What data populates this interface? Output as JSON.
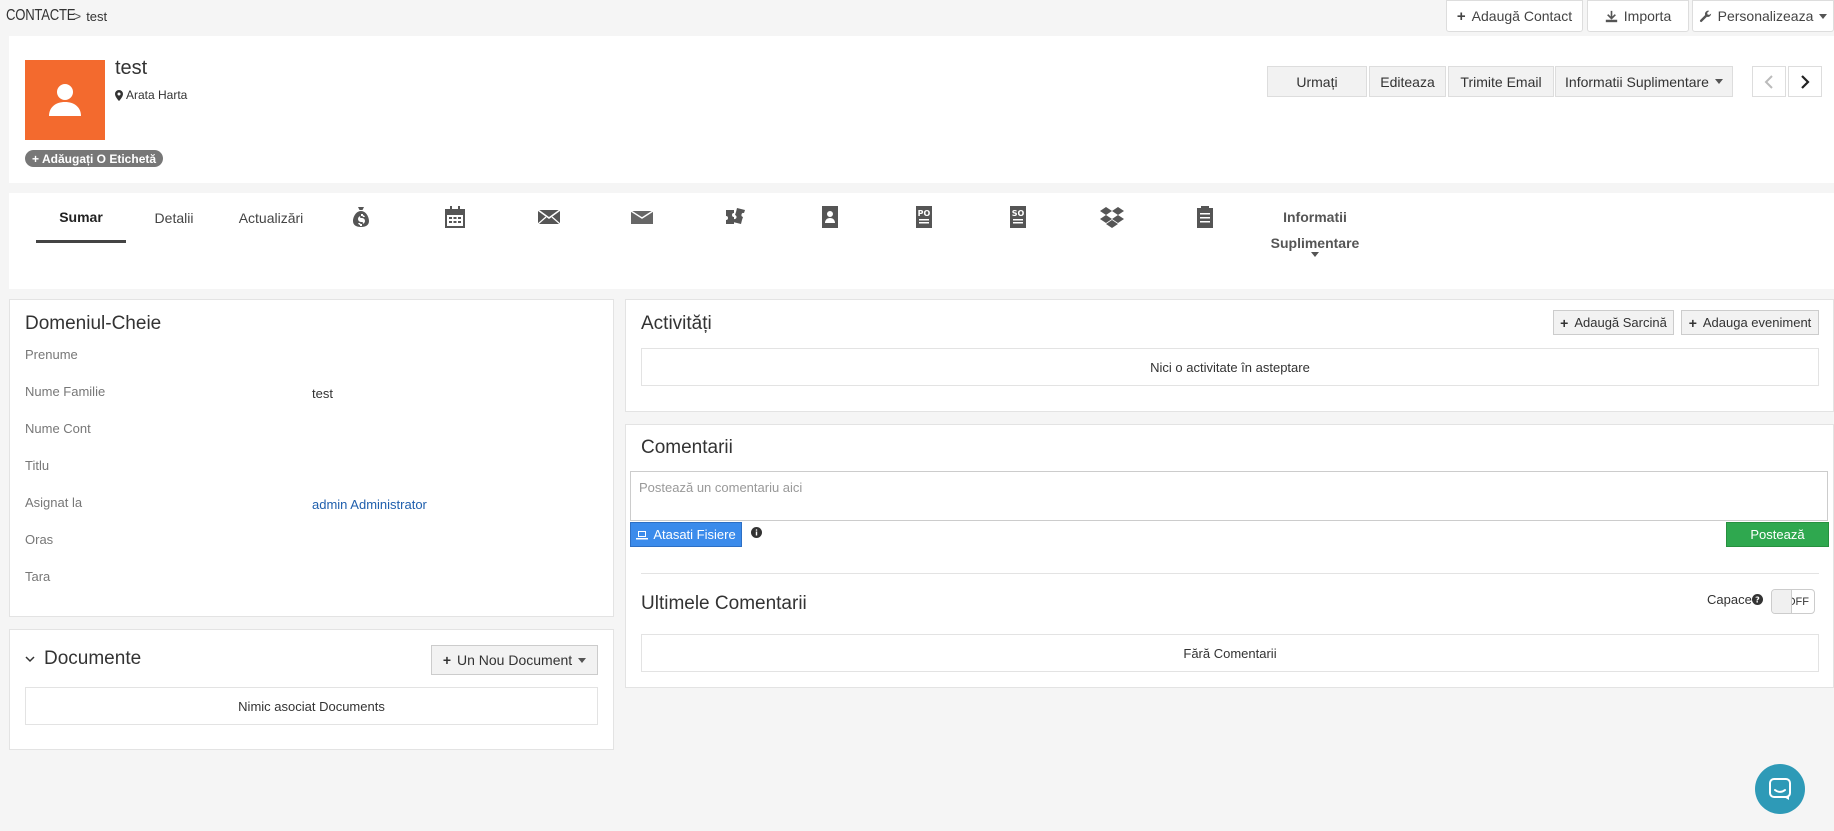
{
  "breadcrumb": {
    "module": "CONTACTE",
    "separator": ">",
    "record": "test"
  },
  "top_actions": {
    "add_contact": "Adaugă Contact",
    "import": "Importa",
    "customize": "Personalizeaza"
  },
  "record": {
    "name": "test",
    "map_link": "Arata Harta",
    "add_tag": "Adăugați O Etichetă"
  },
  "header_actions": {
    "follow": "Urmați",
    "edit": "Editeaza",
    "send_email": "Trimite Email",
    "more_info": "Informatii Suplimentare"
  },
  "tabs": {
    "summary": "Sumar",
    "details": "Detalii",
    "updates": "Actualizări",
    "icons": [
      "money-bag-icon",
      "calendar-icon",
      "envelope-icon",
      "envelope-open-icon",
      "tickets-icon",
      "contact-book-icon",
      "purchase-order-icon",
      "sales-order-icon",
      "dropbox-icon",
      "document-icon"
    ],
    "more_line1": "Informatii",
    "more_line2": "Suplimentare"
  },
  "key_fields": {
    "title": "Domeniul-Cheie",
    "fields": [
      {
        "label": "Prenume",
        "value": ""
      },
      {
        "label": "Nume Familie",
        "value": "test"
      },
      {
        "label": "Nume Cont",
        "value": ""
      },
      {
        "label": "Titlu",
        "value": ""
      },
      {
        "label": "Asignat la",
        "value": "admin Administrator"
      },
      {
        "label": "Oras",
        "value": ""
      },
      {
        "label": "Tara",
        "value": ""
      }
    ]
  },
  "documents": {
    "title": "Documente",
    "new_button": "Un Nou Document",
    "empty": "Nimic asociat Documents"
  },
  "activities": {
    "title": "Activități",
    "add_task": "Adaugă Sarcină",
    "add_event": "Adauga eveniment",
    "empty": "Nici o activitate în asteptare"
  },
  "comments": {
    "title": "Comentarii",
    "placeholder": "Postează un comentariu aici",
    "attach": "Atasati Fisiere",
    "post": "Postează",
    "recent_title": "Ultimele Comentarii",
    "caps_label": "Capace",
    "toggle_state": "OFF",
    "empty": "Fără Comentarii"
  },
  "colors": {
    "avatar": "#f36a2e",
    "attach_button": "#3b8beb",
    "post_button": "#2fa84f",
    "chat_bubble": "#2e9ab7",
    "link": "#1f5fad"
  }
}
